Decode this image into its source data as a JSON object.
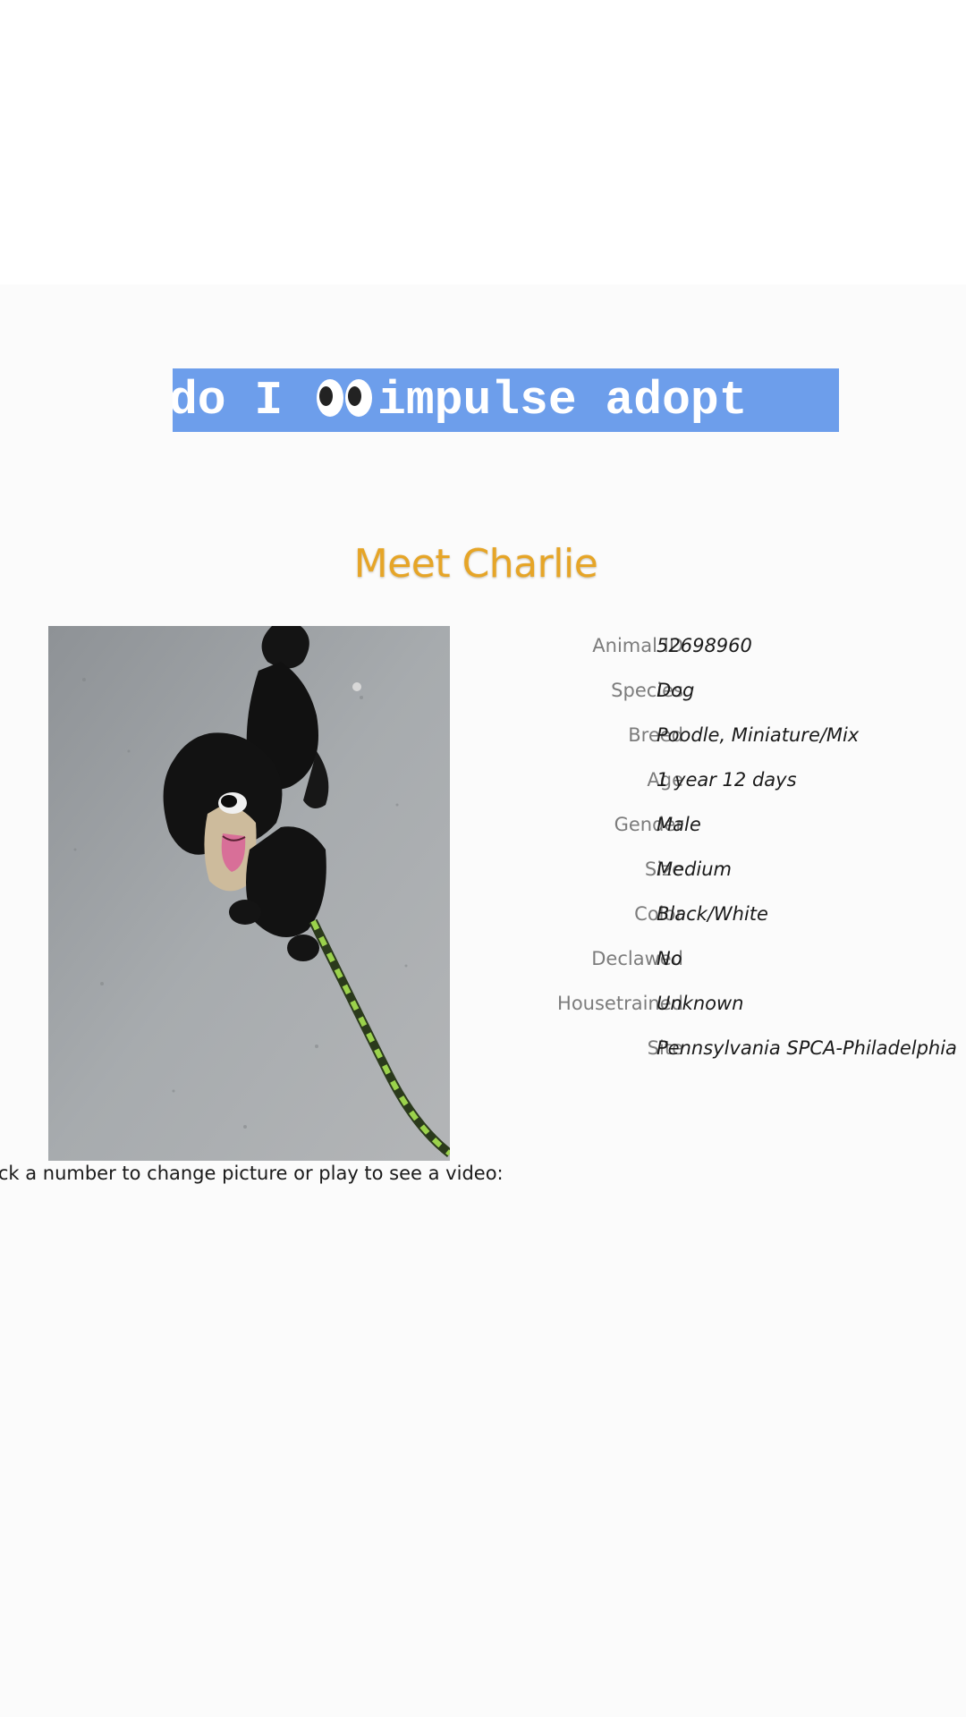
{
  "caption": {
    "text_before": "do I ",
    "icon": "eyes-emoji-icon",
    "text_after": "impulse adopt",
    "background_color": "#6d9eeb"
  },
  "pet": {
    "title": "Meet Charlie",
    "photo": "dog-photo",
    "details": [
      {
        "label": "Animal ID",
        "value": "52698960"
      },
      {
        "label": "Species",
        "value": "Dog"
      },
      {
        "label": "Breed",
        "value": "Poodle, Miniature/Mix"
      },
      {
        "label": "Age",
        "value": "1 year 12 days"
      },
      {
        "label": "Gender",
        "value": "Male"
      },
      {
        "label": "Size",
        "value": "Medium"
      },
      {
        "label": "Color",
        "value": "Black/White"
      },
      {
        "label": "Declawed",
        "value": "No"
      },
      {
        "label": "Housetrained",
        "value": "Unknown"
      },
      {
        "label": "Site",
        "value": "Pennsylvania SPCA-Philadelphia"
      }
    ],
    "media_hint": "ick a number to change picture or play to see a video:"
  },
  "colors": {
    "title": "#e6a527",
    "label": "#7c7c7c",
    "value": "#1a1a1a"
  }
}
